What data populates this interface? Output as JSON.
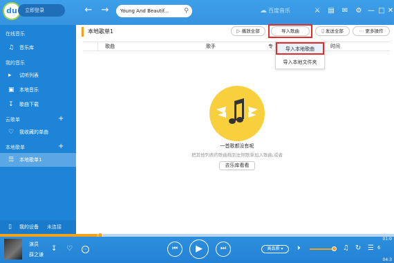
{
  "topbar": {
    "logo_text": "du",
    "login_label": "立即登录",
    "back_icon": "arrow-left-icon",
    "forward_icon": "arrow-right-icon",
    "search_value": "Young And Beautif...",
    "search_icon": "search-icon",
    "brand": "百度音乐",
    "icons": [
      "shirt-icon",
      "briefcase-icon",
      "mail-icon",
      "gear-icon",
      "minimize-icon",
      "maximize-icon",
      "close-icon"
    ]
  },
  "sidebar": {
    "online_head": "在线音乐",
    "music_lib": "音乐库",
    "my_music_head": "我的音乐",
    "trial_list": "试听列表",
    "local_music": "本地音乐",
    "downloads": "歌曲下载",
    "cloud_head": "云歌单",
    "favorites": "我收藏的单曲",
    "local_head": "本地歌单",
    "local_playlist": "本地歌单1",
    "device": "我的设备",
    "device_status": "未连接"
  },
  "main": {
    "title": "本地歌单1",
    "play_all": "播放全部",
    "import_song": "导入歌曲",
    "send_all": "发送全部",
    "more_actions": "更多操作",
    "columns": {
      "song": "歌曲",
      "singer": "歌手",
      "album": "专",
      "time": "时间"
    },
    "menu": {
      "import_local": "导入本地歌曲",
      "import_folder": "导入本地文件夹"
    },
    "empty_title": "一首歌都没有呢",
    "empty_sub": "把其他列表的歌曲拖到左侧歌单加入歌曲,或者",
    "go_library": "去乐库看看"
  },
  "player": {
    "song": "演员",
    "artist": "薛之谦",
    "quality": "高品质",
    "time_current": "01:0",
    "time_total": "04:3",
    "queue_count": "6",
    "progress": 0.255,
    "volume": 0.9,
    "accent": "#f3a21b"
  }
}
